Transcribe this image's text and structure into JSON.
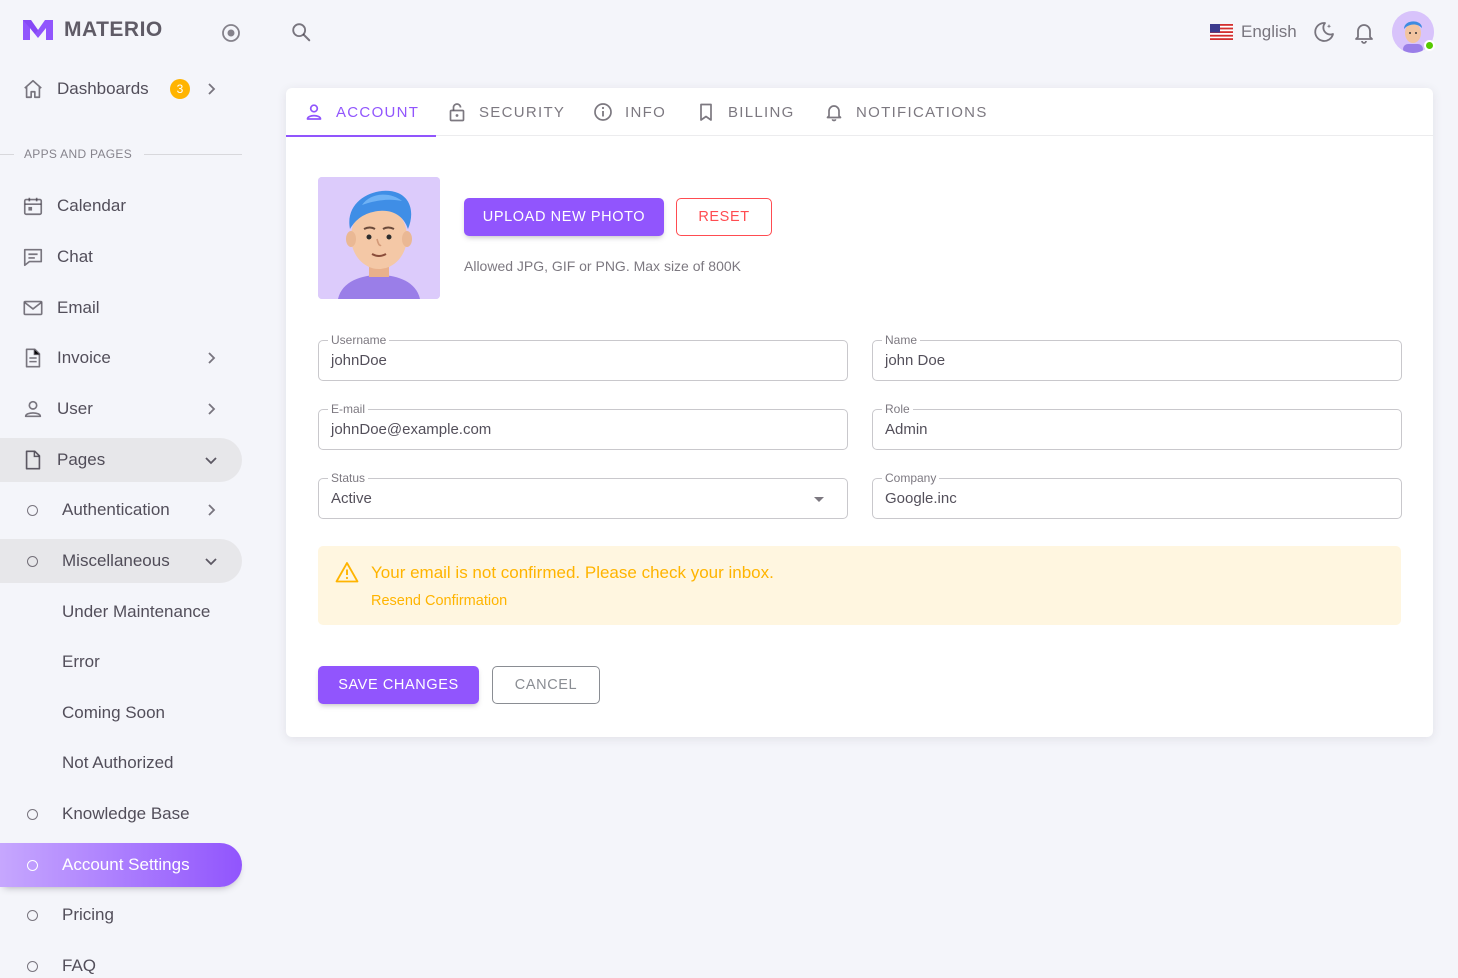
{
  "brand": {
    "name": "MATERIO"
  },
  "sidebar": {
    "dashboards": {
      "label": "Dashboards",
      "badge": "3"
    },
    "section_title": "APPS AND PAGES",
    "items": [
      {
        "label": "Calendar"
      },
      {
        "label": "Chat"
      },
      {
        "label": "Email"
      },
      {
        "label": "Invoice"
      },
      {
        "label": "User"
      },
      {
        "label": "Pages"
      },
      {
        "label": "Authentication"
      },
      {
        "label": "Miscellaneous"
      },
      {
        "label": "Under Maintenance"
      },
      {
        "label": "Error"
      },
      {
        "label": "Coming Soon"
      },
      {
        "label": "Not Authorized"
      },
      {
        "label": "Knowledge Base"
      },
      {
        "label": "Account Settings"
      },
      {
        "label": "Pricing"
      },
      {
        "label": "FAQ"
      }
    ]
  },
  "topbar": {
    "language": "English"
  },
  "tabs": [
    {
      "label": "ACCOUNT"
    },
    {
      "label": "SECURITY"
    },
    {
      "label": "INFO"
    },
    {
      "label": "BILLING"
    },
    {
      "label": "NOTIFICATIONS"
    }
  ],
  "account": {
    "upload_label": "UPLOAD NEW PHOTO",
    "reset_label": "RESET",
    "hint": "Allowed JPG, GIF or PNG. Max size of 800K",
    "fields": {
      "username": {
        "label": "Username",
        "value": "johnDoe"
      },
      "name": {
        "label": "Name",
        "value": "john Doe"
      },
      "email": {
        "label": "E-mail",
        "value": "johnDoe@example.com"
      },
      "role": {
        "label": "Role",
        "value": "Admin"
      },
      "status": {
        "label": "Status",
        "value": "Active"
      },
      "company": {
        "label": "Company",
        "value": "Google.inc"
      }
    },
    "alert": {
      "title": "Your email is not confirmed. Please check your inbox.",
      "link": "Resend Confirmation"
    },
    "save_label": "SAVE CHANGES",
    "cancel_label": "CANCEL"
  },
  "colors": {
    "primary": "#9155fd",
    "warning": "#ffb400",
    "error": "#ff4c51",
    "success": "#56ca00"
  }
}
